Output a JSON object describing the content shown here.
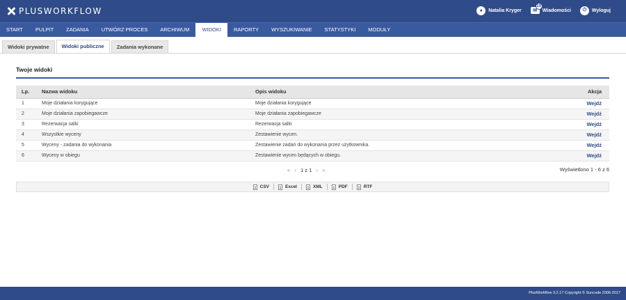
{
  "app": {
    "logo": "PLUSWORKFLOW"
  },
  "user_bar": {
    "user": "Natalia Kryger",
    "messages": "Wiadomości",
    "messages_count": "10",
    "logout": "Wyloguj"
  },
  "nav": [
    "START",
    "PULPIT",
    "ZADANIA",
    "UTWÓRZ PROCES",
    "ARCHIWUM",
    "WIDOKI",
    "RAPORTY",
    "WYSZUKIWANIE",
    "STATYSTYKI",
    "MODUŁY"
  ],
  "nav_active": "WIDOKI",
  "subtabs": [
    "Widoki prywatne",
    "Widoki publiczne",
    "Zadania wykonane"
  ],
  "subtab_active": "Widoki publiczne",
  "section_title": "Twoje widoki",
  "table": {
    "headers": [
      "Lp.",
      "Nazwa widoku",
      "Opis widoku",
      "Akcja"
    ],
    "rows": [
      [
        "1",
        "Moje działania korygujące",
        "Moje działania korygujące",
        "Wejdź"
      ],
      [
        "2",
        "Moje działania zapobiegawcze",
        "Moje działania zapobiegawcze",
        "Wejdź"
      ],
      [
        "3",
        "Rezerwacja salki",
        "Rezerwacja salki",
        "Wejdź"
      ],
      [
        "4",
        "Wszystkie wyceny",
        "Zestawienie wycen.",
        "Wejdź"
      ],
      [
        "5",
        "Wyceny - zadania do wykonania",
        "Zestawienie zadań do wykonania przez użytkownika.",
        "Wejdź"
      ],
      [
        "6",
        "Wyceny w obiegu",
        "Zestawienie wycen będących w obiegu.",
        "Wejdź"
      ]
    ]
  },
  "pager": {
    "first": "«",
    "prev": "‹",
    "info": "1 z 1",
    "next": "›",
    "last": "»",
    "shown": "Wyświetlono 1 - 6 z 6"
  },
  "export": [
    "CSV",
    "Excel",
    "XML",
    "PDF",
    "RTF"
  ],
  "footer": "PlusWorkflow 3.2.17 Copyright © Suncode 2006-2017"
}
